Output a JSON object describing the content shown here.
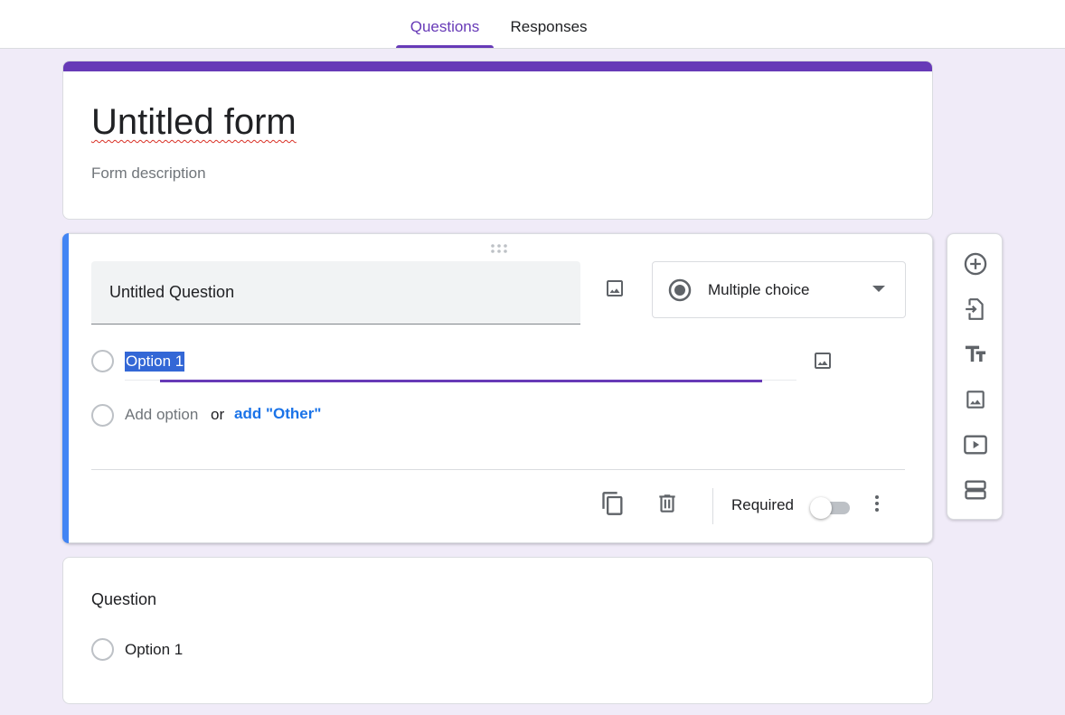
{
  "tabs": [
    {
      "label": "Questions",
      "active": true
    },
    {
      "label": "Responses",
      "active": false
    }
  ],
  "colors": {
    "theme": "#673ab7",
    "background": "#f0ebf8",
    "accent_blue": "#4285f4",
    "link_blue": "#1a73e8"
  },
  "form": {
    "title": "Untitled form",
    "description_placeholder": "Form description"
  },
  "active_question": {
    "title": "Untitled Question",
    "type_label": "Multiple choice",
    "type_icon": "radio-button-checked-icon",
    "options": [
      {
        "label": "Option 1",
        "selected_text": true
      }
    ],
    "add_option_label": "Add option",
    "or_label": "or",
    "add_other_label": "add \"Other\"",
    "required_label": "Required",
    "required": false
  },
  "second_question": {
    "title": "Question",
    "options": [
      {
        "label": "Option 1"
      }
    ]
  },
  "toolbar": {
    "items": [
      {
        "name": "add-question",
        "icon": "add-circle-icon"
      },
      {
        "name": "import-questions",
        "icon": "import-icon"
      },
      {
        "name": "add-title-description",
        "icon": "title-icon"
      },
      {
        "name": "add-image",
        "icon": "image-icon"
      },
      {
        "name": "add-video",
        "icon": "video-icon"
      },
      {
        "name": "add-section",
        "icon": "section-icon"
      }
    ]
  }
}
